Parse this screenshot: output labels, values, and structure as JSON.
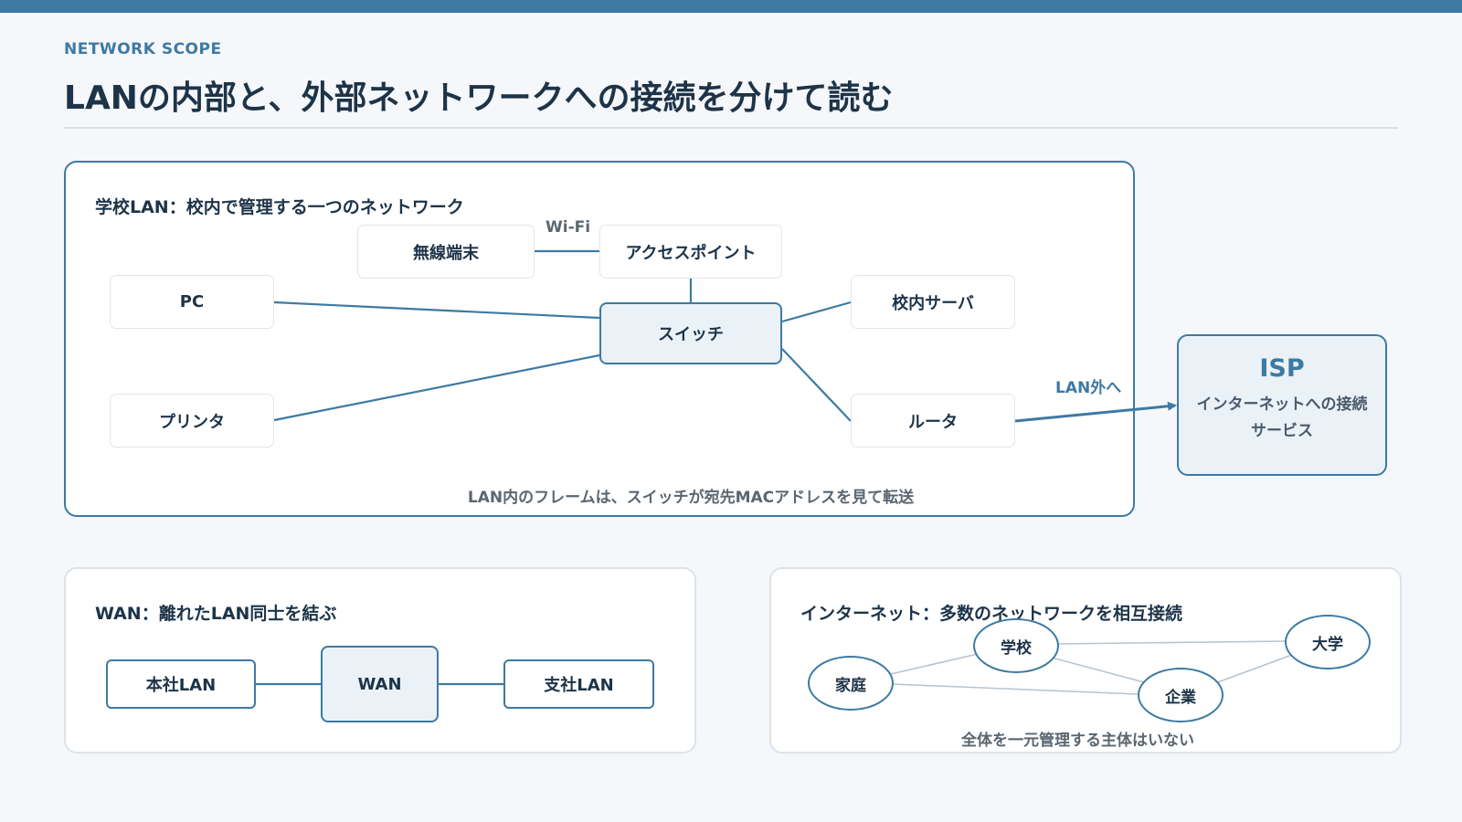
{
  "header": {
    "eyebrow": "NETWORK SCOPE",
    "title": "LANの内部と、外部ネットワークへの接続を分けて読む"
  },
  "lan": {
    "title": "学校LAN：校内で管理する一つのネットワーク",
    "wifi_label": "Wi-Fi",
    "nodes": {
      "wireless": "無線端末",
      "access_point": "アクセスポイント",
      "pc": "PC",
      "switch": "スイッチ",
      "server": "校内サーバ",
      "printer": "プリンタ",
      "router": "ルータ"
    },
    "caption": "LAN内のフレームは、スイッチが宛先MACアドレスを見て転送",
    "out_label": "LAN外へ"
  },
  "isp": {
    "title": "ISP",
    "description": "インターネットへの接続サービス"
  },
  "wan": {
    "title": "WAN：離れたLAN同士を結ぶ",
    "nodes": {
      "head_office": "本社LAN",
      "wan": "WAN",
      "branch": "支社LAN"
    }
  },
  "internet": {
    "title": "インターネット：多数のネットワークを相互接続",
    "nodes": {
      "school": "学校",
      "university": "大学",
      "home": "家庭",
      "company": "企業"
    },
    "caption": "全体を一元管理する主体はいない"
  },
  "colors": {
    "accent": "#3d7aa3",
    "text": "#1d3348",
    "hub_fill": "#eaf2f8",
    "background": "#f5f7fa"
  }
}
